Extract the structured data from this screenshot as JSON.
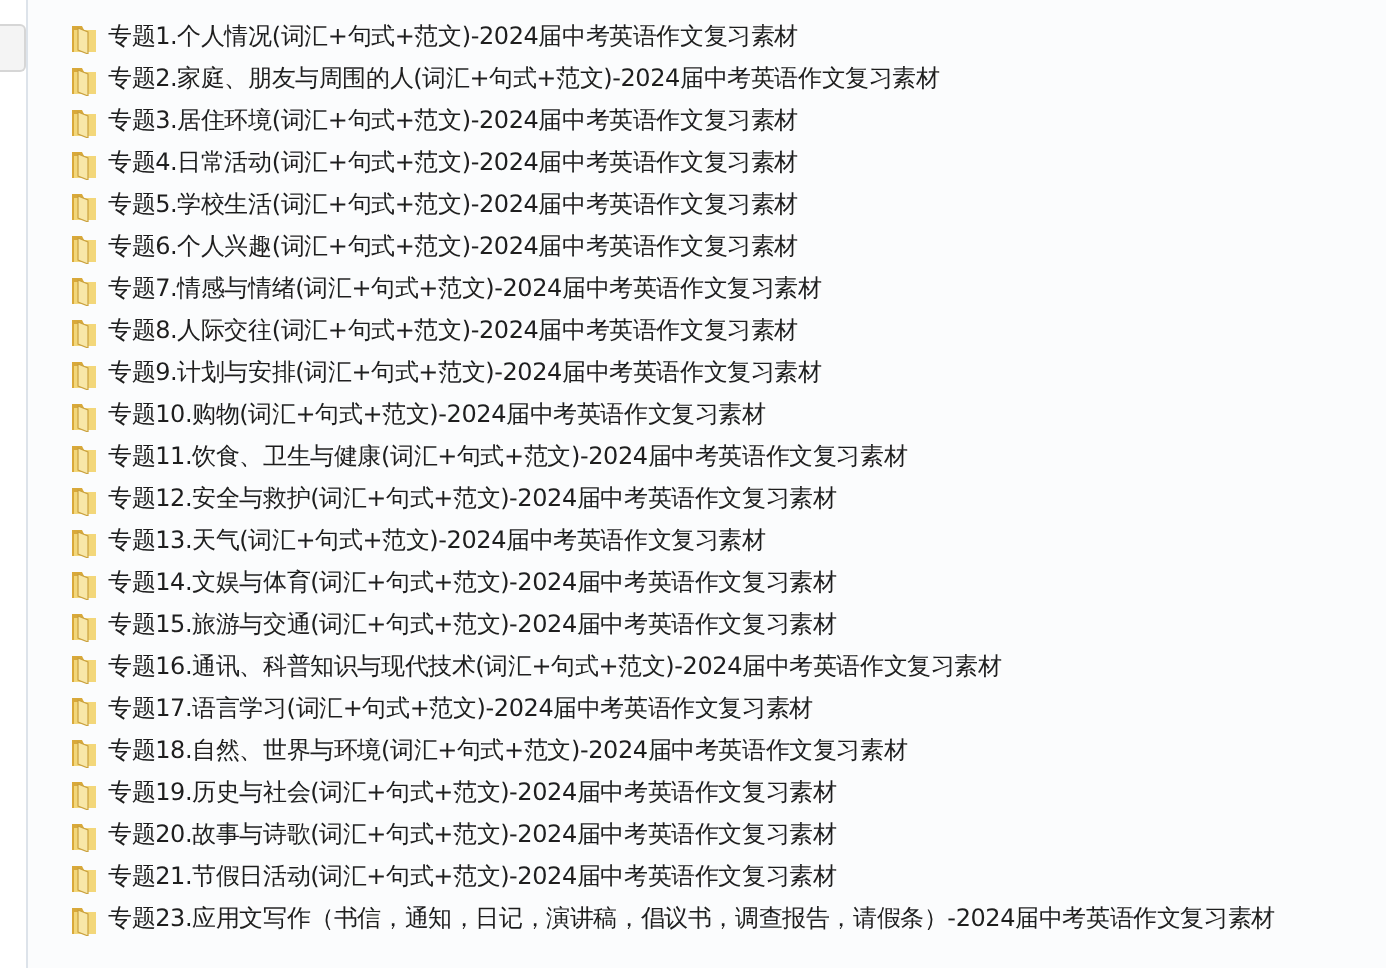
{
  "files": [
    {
      "name": "专题1.个人情况(词汇+句式+范文)-2024届中考英语作文复习素材"
    },
    {
      "name": "专题2.家庭、朋友与周围的人(词汇+句式+范文)-2024届中考英语作文复习素材"
    },
    {
      "name": "专题3.居住环境(词汇+句式+范文)-2024届中考英语作文复习素材"
    },
    {
      "name": "专题4.日常活动(词汇+句式+范文)-2024届中考英语作文复习素材"
    },
    {
      "name": "专题5.学校生活(词汇+句式+范文)-2024届中考英语作文复习素材"
    },
    {
      "name": "专题6.个人兴趣(词汇+句式+范文)-2024届中考英语作文复习素材"
    },
    {
      "name": "专题7.情感与情绪(词汇+句式+范文)-2024届中考英语作文复习素材"
    },
    {
      "name": "专题8.人际交往(词汇+句式+范文)-2024届中考英语作文复习素材"
    },
    {
      "name": "专题9.计划与安排(词汇+句式+范文)-2024届中考英语作文复习素材"
    },
    {
      "name": "专题10.购物(词汇+句式+范文)-2024届中考英语作文复习素材"
    },
    {
      "name": "专题11.饮食、卫生与健康(词汇+句式+范文)-2024届中考英语作文复习素材"
    },
    {
      "name": "专题12.安全与救护(词汇+句式+范文)-2024届中考英语作文复习素材"
    },
    {
      "name": "专题13.天气(词汇+句式+范文)-2024届中考英语作文复习素材"
    },
    {
      "name": "专题14.文娱与体育(词汇+句式+范文)-2024届中考英语作文复习素材"
    },
    {
      "name": "专题15.旅游与交通(词汇+句式+范文)-2024届中考英语作文复习素材"
    },
    {
      "name": "专题16.通讯、科普知识与现代技术(词汇+句式+范文)-2024届中考英语作文复习素材"
    },
    {
      "name": "专题17.语言学习(词汇+句式+范文)-2024届中考英语作文复习素材"
    },
    {
      "name": "专题18.自然、世界与环境(词汇+句式+范文)-2024届中考英语作文复习素材"
    },
    {
      "name": "专题19.历史与社会(词汇+句式+范文)-2024届中考英语作文复习素材"
    },
    {
      "name": "专题20.故事与诗歌(词汇+句式+范文)-2024届中考英语作文复习素材"
    },
    {
      "name": "专题21.节假日活动(词汇+句式+范文)-2024届中考英语作文复习素材"
    },
    {
      "name": "专题23.应用文写作（书信，通知，日记，演讲稿，倡议书，调查报告，请假条）-2024届中考英语作文复习素材"
    }
  ]
}
